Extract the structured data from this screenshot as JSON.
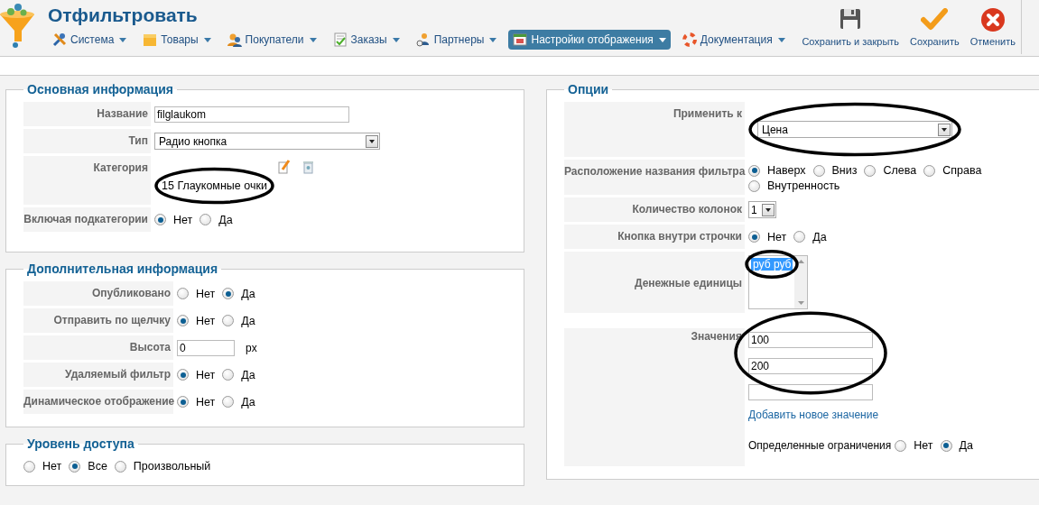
{
  "header": {
    "title": "Отфильтровать",
    "menu": [
      {
        "label": "Система",
        "selected": false
      },
      {
        "label": "Товары",
        "selected": false
      },
      {
        "label": "Покупатели",
        "selected": false
      },
      {
        "label": "Заказы",
        "selected": false
      },
      {
        "label": "Партнеры",
        "selected": false
      },
      {
        "label": "Настройки отображения",
        "selected": true
      },
      {
        "label": "Документация",
        "selected": false
      }
    ],
    "toolbar": [
      {
        "label": "Сохранить и закрыть",
        "kind": "save-close"
      },
      {
        "label": "Сохранить",
        "kind": "save"
      },
      {
        "label": "Отменить",
        "kind": "cancel"
      }
    ]
  },
  "sections": [
    {
      "title": "Основная информация",
      "rows": [
        {
          "kind": "text",
          "label": "Название",
          "value": "filglaukom"
        },
        {
          "kind": "select",
          "label": "Тип",
          "value": "Радио кнопка"
        },
        {
          "kind": "category",
          "label": "Категория",
          "value": "15 Глаукомные очки",
          "circled": true
        },
        {
          "kind": "radio",
          "label": "Включая подкатегории",
          "options": [
            {
              "label": "Нет",
              "selected": true
            },
            {
              "label": "Да",
              "selected": false
            }
          ]
        }
      ]
    },
    {
      "title": "Дополнительная информация",
      "rows": [
        {
          "kind": "radio",
          "label": "Опубликовано",
          "options": [
            {
              "label": "Нет",
              "selected": false
            },
            {
              "label": "Да",
              "selected": true
            }
          ]
        },
        {
          "kind": "radio",
          "label": "Отправить по щелчку",
          "options": [
            {
              "label": "Нет",
              "selected": true
            },
            {
              "label": "Да",
              "selected": false
            }
          ]
        },
        {
          "kind": "size",
          "label": "Высота",
          "value": "0",
          "unit": "px"
        },
        {
          "kind": "radio",
          "label": "Удаляемый фильтр",
          "options": [
            {
              "label": "Нет",
              "selected": true
            },
            {
              "label": "Да",
              "selected": false
            }
          ]
        },
        {
          "kind": "radio",
          "label": "Динамическое отображение",
          "options": [
            {
              "label": "Нет",
              "selected": true
            },
            {
              "label": "Да",
              "selected": false
            }
          ]
        }
      ]
    },
    {
      "title": "Уровень доступа",
      "rows": [
        {
          "kind": "radio",
          "options": [
            {
              "label": "Нет",
              "selected": false
            },
            {
              "label": "Все",
              "selected": true
            },
            {
              "label": "Произвольный",
              "selected": false
            }
          ]
        }
      ]
    },
    {
      "title": "Опции",
      "rows": [
        {
          "kind": "select",
          "label": "Применить к",
          "value": "Цена",
          "circled": true
        },
        {
          "kind": "radio",
          "label": "Расположение названия фильтра",
          "options": [
            {
              "label": "Наверх",
              "selected": true
            },
            {
              "label": "Вниз",
              "selected": false
            },
            {
              "label": "Слева",
              "selected": false
            },
            {
              "label": "Справа",
              "selected": false
            },
            {
              "label": "Внутренность",
              "selected": false
            }
          ]
        },
        {
          "kind": "small-select",
          "label": "Количество колонок",
          "value": "1"
        },
        {
          "kind": "radio",
          "label": "Кнопка внутри строчки",
          "options": [
            {
              "label": "Нет",
              "selected": true
            },
            {
              "label": "Да",
              "selected": false
            }
          ]
        },
        {
          "kind": "listbox",
          "label": "Денежные единицы",
          "circled": true,
          "options": [
            {
              "label": "руб руб",
              "selected": true
            }
          ]
        },
        {
          "kind": "values",
          "label": "Значения",
          "fields": [
            {
              "kind": "input",
              "value": "100",
              "circled": true
            },
            {
              "kind": "input",
              "value": "200",
              "circled": true
            },
            {
              "kind": "input"
            }
          ],
          "link": "Добавить новое значение",
          "limit": {
            "label": "Определенные ограничения",
            "options": [
              {
                "label": "Нет",
                "selected": false
              },
              {
                "label": "Да",
                "selected": true
              }
            ]
          }
        }
      ]
    }
  ]
}
